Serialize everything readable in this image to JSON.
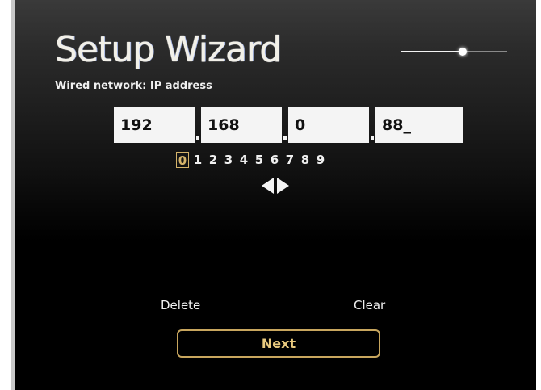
{
  "wizard": {
    "title": "Setup Wizard",
    "subtitle": "Wired network: IP address",
    "progress": 0.58
  },
  "ip_address": {
    "octets": [
      "192",
      "168",
      "0",
      "88_"
    ],
    "separator_glyph": "."
  },
  "digit_picker": {
    "digits": [
      "0",
      "1",
      "2",
      "3",
      "4",
      "5",
      "6",
      "7",
      "8",
      "9"
    ],
    "selected": "0",
    "left_arrow_icon": "triangle-left-icon",
    "right_arrow_icon": "triangle-right-icon"
  },
  "actions": {
    "delete_label": "Delete",
    "clear_label": "Clear",
    "next_label": "Next"
  },
  "colors": {
    "accent": "#d4b36a",
    "text": "#f0f0f0",
    "field_bg": "#f4f4f4",
    "background": "#000000"
  }
}
